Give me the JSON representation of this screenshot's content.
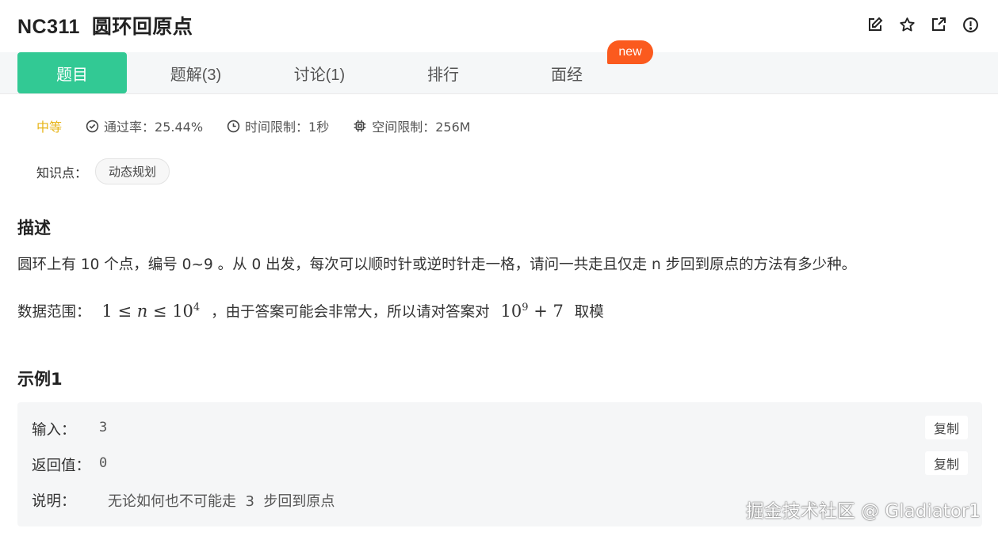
{
  "problem": {
    "id": "NC311",
    "title": "圆环回原点"
  },
  "header_icons": [
    "edit-icon",
    "star-icon",
    "share-icon",
    "report-icon"
  ],
  "tabs": [
    {
      "label": "题目",
      "active": true
    },
    {
      "label": "题解(3)"
    },
    {
      "label": "讨论(1)"
    },
    {
      "label": "排行"
    },
    {
      "label": "面经"
    }
  ],
  "new_badge": "new",
  "meta": {
    "difficulty": "中等",
    "pass_rate": "通过率：25.44%",
    "time_limit": "时间限制：1秒",
    "memory_limit": "空间限制：256M"
  },
  "knowledge": {
    "label": "知识点：",
    "tag": "动态规划"
  },
  "description": {
    "heading": "描述",
    "text": "圆环上有 10 个点，编号 0~9 。从 0 出发，每次可以顺时针或逆时针走一格，请问一共走且仅走 n 步回到原点的方法有多少种。",
    "range_label": "数据范围：",
    "range_text": "，由于答案可能会非常大，所以请对答案对",
    "range_tail": "取模",
    "math1_a": "1 ≤ ",
    "math1_n": "n",
    "math1_b": " ≤ 10",
    "math1_exp": "4",
    "math2_base": "10",
    "math2_exp": "9",
    "math2_tail": " + 7"
  },
  "example": {
    "heading": "示例1",
    "input_label": "输入：",
    "input_value": "3",
    "output_label": "返回值：",
    "output_value": "0",
    "explain_label": "说明：",
    "explain_value": "无论如何也不可能走  3  步回到原点",
    "copy_label": "复制"
  },
  "watermark": "掘金技术社区 @ Gladiator1",
  "colors": {
    "accent": "#32c994",
    "badge": "#fb5a1e",
    "difficulty": "#e7b416"
  }
}
